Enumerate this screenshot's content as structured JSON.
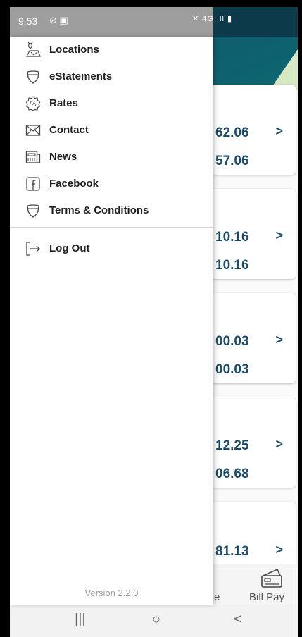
{
  "status_bar": {
    "time": "9:53",
    "left_icons": "⊘ ▣",
    "right_icons": "✕ 4G ıll ▮"
  },
  "drawer": {
    "items": [
      {
        "label": "Locations",
        "icon": "map-pin-icon"
      },
      {
        "label": "eStatements",
        "icon": "shield-icon"
      },
      {
        "label": "Rates",
        "icon": "percent-badge-icon"
      },
      {
        "label": "Contact",
        "icon": "envelope-icon"
      },
      {
        "label": "News",
        "icon": "newspaper-icon"
      },
      {
        "label": "Facebook",
        "icon": "facebook-icon"
      },
      {
        "label": "Terms & Conditions",
        "icon": "shield-icon"
      }
    ],
    "logout_label": "Log Out",
    "version": "Version 2.2.0"
  },
  "background": {
    "cards": [
      {
        "v1": "62.06",
        "v2": "57.06"
      },
      {
        "v1": "10.16",
        "v2": "10.16"
      },
      {
        "v1": "00.03",
        "v2": "00.03"
      },
      {
        "v1": "12.25",
        "v2": "06.68"
      },
      {
        "v1": "81.13",
        "v2": ""
      }
    ],
    "chevron": ">",
    "bottom_nav": {
      "partial_label": "e",
      "billpay_label": "Bill Pay"
    }
  },
  "system_nav": {
    "recent": "|||",
    "home": "○",
    "back": "<"
  },
  "colors": {
    "header": "#0b4a5e",
    "card_value": "#1b4c6b",
    "drawer_bg": "#ffffff"
  }
}
